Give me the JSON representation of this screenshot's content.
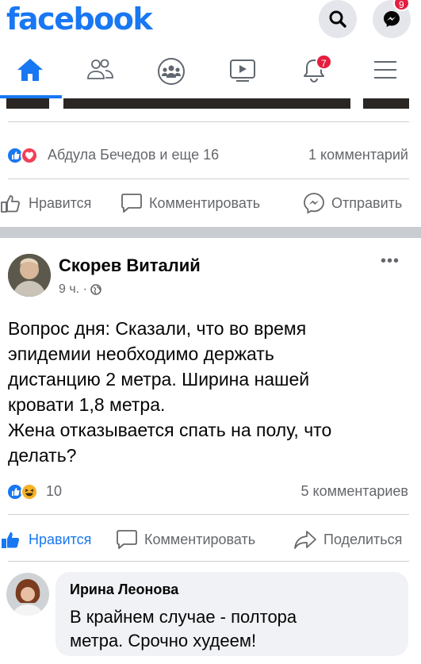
{
  "app": {
    "logo_text": "facebook",
    "brand_color": "#1877f2"
  },
  "header": {
    "search_icon": "search-icon",
    "messenger_icon": "messenger-icon",
    "messenger_badge": "9"
  },
  "nav": {
    "items": [
      {
        "icon": "home-icon",
        "active": true
      },
      {
        "icon": "friends-icon",
        "active": false
      },
      {
        "icon": "groups-icon",
        "active": false
      },
      {
        "icon": "watch-icon",
        "active": false
      },
      {
        "icon": "bell-icon",
        "active": false,
        "badge": "7"
      },
      {
        "icon": "menu-icon",
        "active": false
      }
    ]
  },
  "prev_post": {
    "reactions_text": "Абдула Бечедов и еще 16",
    "comments_count": "1 комментарий",
    "actions": {
      "like": "Нравится",
      "comment": "Комментировать",
      "send": "Отправить"
    }
  },
  "post": {
    "author": "Скорев Виталий",
    "time": "9 ч. ·",
    "text_lines": [
      "Вопрос дня: Сказали, что во время",
      "эпидемии необходимо держать",
      "дистанцию 2 метра. Ширина нашей",
      "кровати 1,8 метра.",
      "Жена отказывается спать на полу, что",
      "делать?"
    ],
    "reactions_count": "10",
    "comments_count": "5 комментариев",
    "actions": {
      "like": "Нравится",
      "comment": "Комментировать",
      "share": "Поделиться"
    }
  },
  "comment": {
    "author": "Ирина Леонова",
    "text_lines": [
      "В крайнем случае - полтора",
      "метра. Срочно худеем!"
    ]
  },
  "colors": {
    "notification": "#e41e3f",
    "secondary_text": "#65676b",
    "bubble_bg": "#f0f2f5"
  }
}
